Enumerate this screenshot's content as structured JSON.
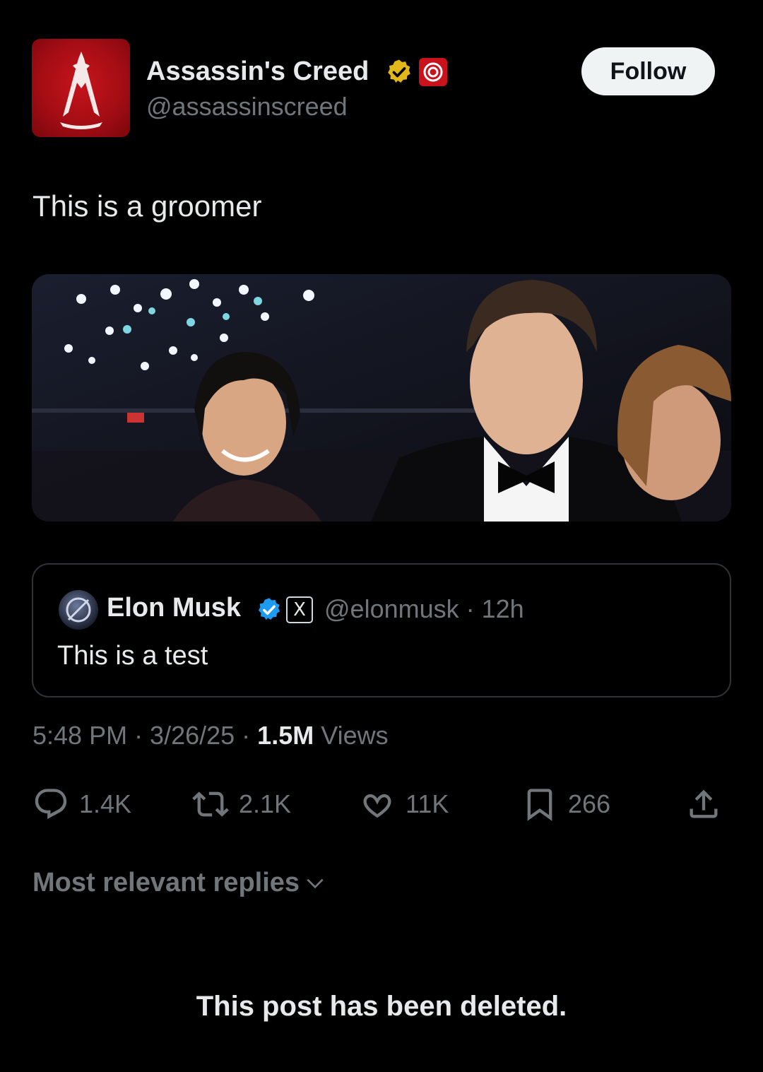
{
  "author": {
    "display_name": "Assassin's Creed",
    "handle": "@assassinscreed",
    "avatar_icon": "assassins-creed-logo-icon",
    "badges": [
      "gold-verified-badge-icon",
      "ubisoft-affiliate-icon"
    ],
    "follow_label": "Follow"
  },
  "tweet": {
    "text": "This is a groomer",
    "media_description": ""
  },
  "quoted": {
    "display_name": "Elon Musk",
    "handle_time": "@elonmusk · 12h",
    "x_badge": "X",
    "text": "This is a test"
  },
  "meta": {
    "time_date": "5:48 PM · 3/26/25 · ",
    "views_count": "1.5M",
    "views_label": " Views"
  },
  "actions": {
    "replies": "1.4K",
    "reposts": "2.1K",
    "likes": "11K",
    "bookmarks": "266"
  },
  "replies_section": {
    "sort_label": "Most relevant replies",
    "deleted_notice": "This post has been deleted."
  },
  "colors": {
    "background": "#000000",
    "text_primary": "#e7e9ea",
    "text_secondary": "#71767b",
    "verified_blue": "#1d9bf0",
    "gold_badge": "#e2b719",
    "brand_red": "#c9121b"
  }
}
